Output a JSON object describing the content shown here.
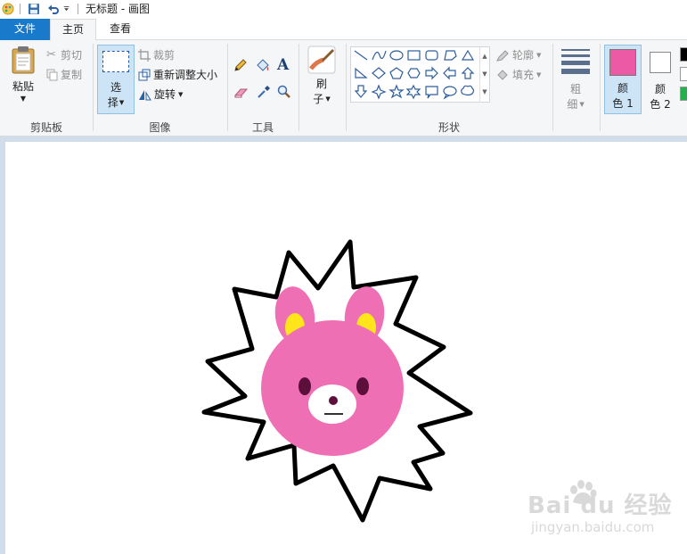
{
  "titlebar": {
    "title": "无标题 - 画图"
  },
  "tabs": {
    "file": "文件",
    "home": "主页",
    "view": "查看"
  },
  "clipboard": {
    "paste": "粘贴",
    "cut": "剪切",
    "copy": "复制",
    "label": "剪贴板"
  },
  "image": {
    "select_line1": "选",
    "select_line2": "择",
    "crop": "裁剪",
    "resize": "重新调整大小",
    "rotate": "旋转",
    "label": "图像"
  },
  "tools": {
    "label": "工具"
  },
  "brushes": {
    "line1": "刷",
    "line2": "子"
  },
  "shapes": {
    "outline": "轮廓",
    "fill": "填充",
    "label": "形状"
  },
  "size": {
    "line1": "粗",
    "line2": "细"
  },
  "colors": {
    "color1_line1": "颜",
    "color1_line2": "色 1",
    "color2_line1": "颜",
    "color2_line2": "色 2",
    "color1_value": "#ec5aa5",
    "color2_value": "#ffffff",
    "accent": "#1979ca"
  },
  "watermark": {
    "brand": "Bai du 经验",
    "url": "jingyan.baidu.com"
  }
}
